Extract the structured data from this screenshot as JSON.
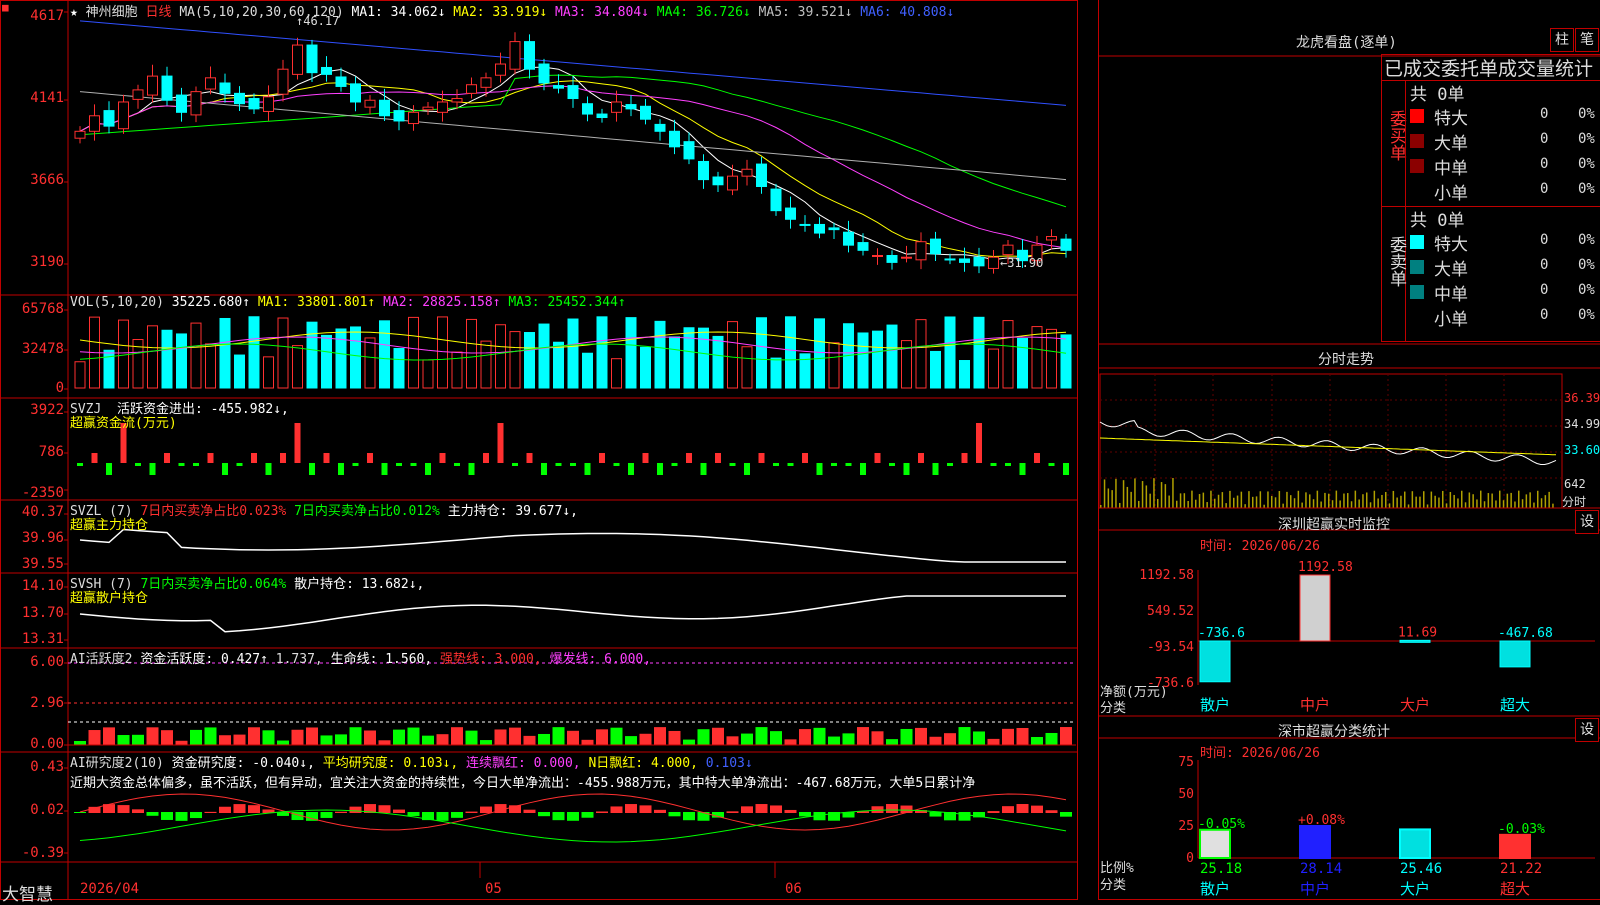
{
  "header": {
    "stock_name": "神州细胞",
    "period": "日线",
    "ma_label": "MA(5,10,20,30,60,120)",
    "ma1": "MA1: 34.062↓",
    "ma2": "MA2: 33.919↓",
    "ma3": "MA3: 34.804↓",
    "ma4": "MA4: 36.726↓",
    "ma5": "MA5: 39.521↓",
    "ma6": "MA6: 40.808↓",
    "high_mark": "46.17",
    "low_mark": "31.90",
    "price_ticks": [
      "4617",
      "4141",
      "3666",
      "3190"
    ]
  },
  "vol": {
    "label": "VOL(5,10,20)",
    "val": "35225.680↑",
    "ma1": "MA1: 33801.801↑",
    "ma2": "MA2: 28825.158↑",
    "ma3": "MA3: 25452.344↑",
    "ticks": [
      "65768",
      "32478",
      "0"
    ]
  },
  "svzj": {
    "label": "SVZJ",
    "line1": "活跃资金进出: -455.982↓,",
    "line2": "超赢资金流(万元)",
    "ticks": [
      "3922",
      "786",
      "-2350"
    ]
  },
  "svzl": {
    "label": "SVZL (7)",
    "a": "7日内买卖净占比0.023%",
    "b": "7日内买卖净占比0.012%",
    "c": "主力持仓: 39.677↓,",
    "line2": "超赢主力持仓",
    "ticks": [
      "40.37",
      "39.96",
      "39.55"
    ]
  },
  "svsh": {
    "label": "SVSH (7)",
    "a": "7日内买卖净占比0.064%",
    "c": "散户持仓: 13.682↓,",
    "line2": "超赢散户持仓",
    "ticks": [
      "14.10",
      "13.70",
      "13.31"
    ]
  },
  "ai1": {
    "label": "AI活跃度2",
    "a": "资金活跃度: 0.427↑",
    "b": "1.737,",
    "c": "生命线: 1.560,",
    "d": "强势线: 3.000,",
    "e": "爆发线: 6.000,",
    "ticks": [
      "6.00",
      "2.96",
      "0.00"
    ]
  },
  "ai2": {
    "label": "AI研究度2(10)",
    "a": "资金研究度: -0.040↓,",
    "b": "平均研究度: 0.103↓,",
    "c": "连续飘红: 0.000,",
    "d": "N日飘红: 4.000,",
    "e": "0.103↓",
    "comment": "近期大资金总体偏多，虽不活跃，但有异动，宜关注大资金的持续性，今日大单净流出：-455.988万元，其中特大单净流出：-467.68万元，大单5日累计净",
    "ticks": [
      "0.43",
      "0.02",
      "-0.39"
    ]
  },
  "bottom": {
    "brand": "大智慧",
    "dates": [
      "2026/04",
      "05",
      "06"
    ]
  },
  "dragon": {
    "title": "龙虎看盘(逐单)",
    "btn1": "柱",
    "btn2": "笔",
    "header": "已成交委托单成交量统计",
    "buy_label": "委买单",
    "sell_label": "委卖单",
    "buy_total": "共 0单",
    "sell_total": "共 0单",
    "rows": [
      "特大",
      "大单",
      "中单",
      "小单"
    ],
    "zero": "0",
    "pct": "0%"
  },
  "intraday": {
    "title": "分时走势",
    "ticks": [
      "36.39",
      "34.99",
      "33.60",
      "642"
    ],
    "unit": "分时"
  },
  "monitor": {
    "title": "深圳超赢实时监控",
    "btn": "设",
    "time": "时间: 2026/06/26",
    "ticks": [
      "1192.58",
      "549.52",
      "-93.54",
      "-736.6"
    ],
    "ylabel": "净额(万元)",
    "xlabel": "分类",
    "cats": [
      "散户",
      "中户",
      "大户",
      "超大"
    ],
    "values": [
      -736.6,
      1192.58,
      11.69,
      -467.68
    ],
    "value_labels": [
      "-736.6",
      "1192.58",
      "11.69",
      "-467.68"
    ]
  },
  "classify": {
    "title": "深市超赢分类统计",
    "btn": "设",
    "time": "时间: 2026/06/26",
    "ticks": [
      "75",
      "50",
      "25",
      "0"
    ],
    "ylabel": "比例%",
    "xlabel": "分类",
    "cats": [
      "散户",
      "中户",
      "大户",
      "超大"
    ],
    "values": [
      25.18,
      28.14,
      25.46,
      21.22
    ],
    "changes": [
      "-0.05%",
      "+0.08%",
      "",
      "-0.03%"
    ],
    "value_labels": [
      "25.18",
      "28.14",
      "25.46",
      "21.22"
    ]
  },
  "chart_data": {
    "type": "candlestick",
    "title": "神州细胞 日线",
    "ylabel": "",
    "ylim": [
      31.0,
      47.0
    ],
    "x_ticks": [
      "2026/04",
      "05",
      "06"
    ],
    "close_series": [
      40.2,
      41.1,
      40.5,
      41.9,
      42.6,
      43.4,
      42.0,
      41.3,
      42.5,
      43.3,
      42.4,
      41.8,
      41.5,
      42.2,
      43.8,
      45.2,
      43.6,
      43.5,
      42.8,
      41.9,
      42.0,
      41.1,
      40.8,
      41.3,
      41.6,
      41.9,
      42.1,
      42.9,
      43.3,
      44.1,
      45.4,
      43.8,
      43.0,
      42.7,
      42.1,
      41.2,
      41.0,
      41.9,
      41.5,
      40.9,
      40.2,
      39.3,
      38.6,
      37.4,
      37.1,
      37.6,
      38.0,
      37.0,
      35.6,
      35.1,
      34.8,
      34.3,
      34.5,
      33.6,
      33.3,
      33.0,
      32.6,
      32.9,
      33.8,
      33.1,
      32.8,
      32.6,
      32.4,
      32.9,
      33.6,
      32.7,
      33.6,
      34.1,
      33.3
    ]
  }
}
